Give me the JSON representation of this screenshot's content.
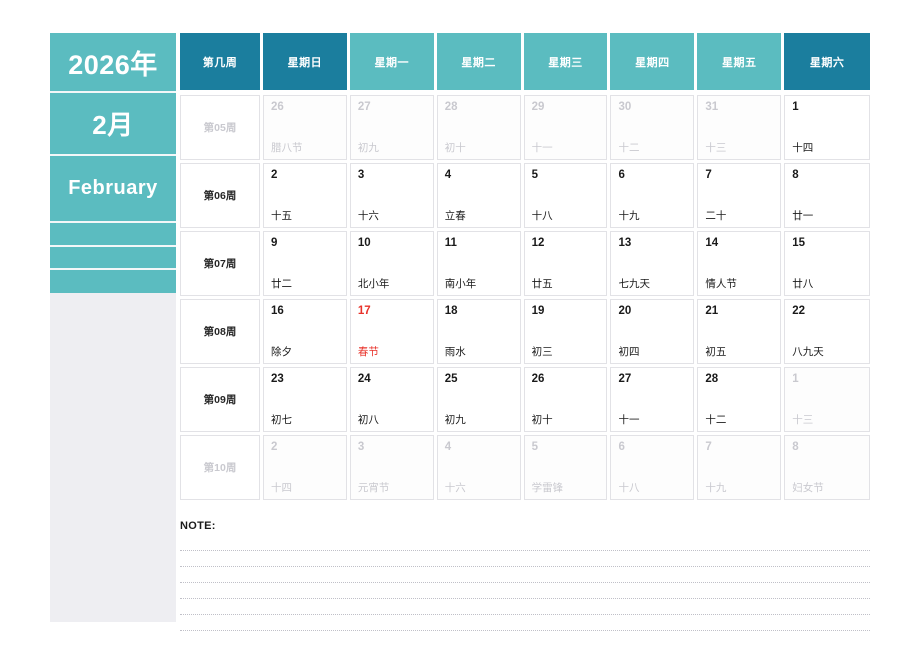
{
  "sidebar": {
    "year": "2026年",
    "month": "2月",
    "month_english": "February",
    "panel_color": "#5bbcc0",
    "panel_bg": "#eeeef2"
  },
  "colors": {
    "header_dark": "#1b7e9e",
    "header_light": "#5bbcc0",
    "holiday_red": "#e8322a",
    "out_of_month": "#c9c9cf"
  },
  "header": {
    "week_number_label": "第几周",
    "days": [
      "星期日",
      "星期一",
      "星期二",
      "星期三",
      "星期四",
      "星期五",
      "星期六"
    ]
  },
  "weeks": [
    {
      "label": "第05周",
      "dim_label": true,
      "days": [
        {
          "num": "26",
          "lunar": "腊八节",
          "out": true,
          "holiday": false
        },
        {
          "num": "27",
          "lunar": "初九",
          "out": true,
          "holiday": false
        },
        {
          "num": "28",
          "lunar": "初十",
          "out": true,
          "holiday": false
        },
        {
          "num": "29",
          "lunar": "十一",
          "out": true,
          "holiday": false
        },
        {
          "num": "30",
          "lunar": "十二",
          "out": true,
          "holiday": false
        },
        {
          "num": "31",
          "lunar": "十三",
          "out": true,
          "holiday": false
        },
        {
          "num": "1",
          "lunar": "十四",
          "out": false,
          "holiday": false
        }
      ]
    },
    {
      "label": "第06周",
      "dim_label": false,
      "days": [
        {
          "num": "2",
          "lunar": "十五",
          "out": false,
          "holiday": false
        },
        {
          "num": "3",
          "lunar": "十六",
          "out": false,
          "holiday": false
        },
        {
          "num": "4",
          "lunar": "立春",
          "out": false,
          "holiday": false
        },
        {
          "num": "5",
          "lunar": "十八",
          "out": false,
          "holiday": false
        },
        {
          "num": "6",
          "lunar": "十九",
          "out": false,
          "holiday": false
        },
        {
          "num": "7",
          "lunar": "二十",
          "out": false,
          "holiday": false
        },
        {
          "num": "8",
          "lunar": "廿一",
          "out": false,
          "holiday": false
        }
      ]
    },
    {
      "label": "第07周",
      "dim_label": false,
      "days": [
        {
          "num": "9",
          "lunar": "廿二",
          "out": false,
          "holiday": false
        },
        {
          "num": "10",
          "lunar": "北小年",
          "out": false,
          "holiday": false
        },
        {
          "num": "11",
          "lunar": "南小年",
          "out": false,
          "holiday": false
        },
        {
          "num": "12",
          "lunar": "廿五",
          "out": false,
          "holiday": false
        },
        {
          "num": "13",
          "lunar": "七九天",
          "out": false,
          "holiday": false
        },
        {
          "num": "14",
          "lunar": "情人节",
          "out": false,
          "holiday": false
        },
        {
          "num": "15",
          "lunar": "廿八",
          "out": false,
          "holiday": false
        }
      ]
    },
    {
      "label": "第08周",
      "dim_label": false,
      "days": [
        {
          "num": "16",
          "lunar": "除夕",
          "out": false,
          "holiday": false
        },
        {
          "num": "17",
          "lunar": "春节",
          "out": false,
          "holiday": true
        },
        {
          "num": "18",
          "lunar": "雨水",
          "out": false,
          "holiday": false
        },
        {
          "num": "19",
          "lunar": "初三",
          "out": false,
          "holiday": false
        },
        {
          "num": "20",
          "lunar": "初四",
          "out": false,
          "holiday": false
        },
        {
          "num": "21",
          "lunar": "初五",
          "out": false,
          "holiday": false
        },
        {
          "num": "22",
          "lunar": "八九天",
          "out": false,
          "holiday": false
        }
      ]
    },
    {
      "label": "第09周",
      "dim_label": false,
      "days": [
        {
          "num": "23",
          "lunar": "初七",
          "out": false,
          "holiday": false
        },
        {
          "num": "24",
          "lunar": "初八",
          "out": false,
          "holiday": false
        },
        {
          "num": "25",
          "lunar": "初九",
          "out": false,
          "holiday": false
        },
        {
          "num": "26",
          "lunar": "初十",
          "out": false,
          "holiday": false
        },
        {
          "num": "27",
          "lunar": "十一",
          "out": false,
          "holiday": false
        },
        {
          "num": "28",
          "lunar": "十二",
          "out": false,
          "holiday": false
        },
        {
          "num": "1",
          "lunar": "十三",
          "out": true,
          "holiday": false
        }
      ]
    },
    {
      "label": "第10周",
      "dim_label": true,
      "days": [
        {
          "num": "2",
          "lunar": "十四",
          "out": true,
          "holiday": false
        },
        {
          "num": "3",
          "lunar": "元宵节",
          "out": true,
          "holiday": false
        },
        {
          "num": "4",
          "lunar": "十六",
          "out": true,
          "holiday": false
        },
        {
          "num": "5",
          "lunar": "学雷锋",
          "out": true,
          "holiday": false
        },
        {
          "num": "6",
          "lunar": "十八",
          "out": true,
          "holiday": false
        },
        {
          "num": "7",
          "lunar": "十九",
          "out": true,
          "holiday": false
        },
        {
          "num": "8",
          "lunar": "妇女节",
          "out": true,
          "holiday": false
        }
      ]
    }
  ],
  "note": {
    "label": "NOTE:",
    "line_count": 6
  }
}
